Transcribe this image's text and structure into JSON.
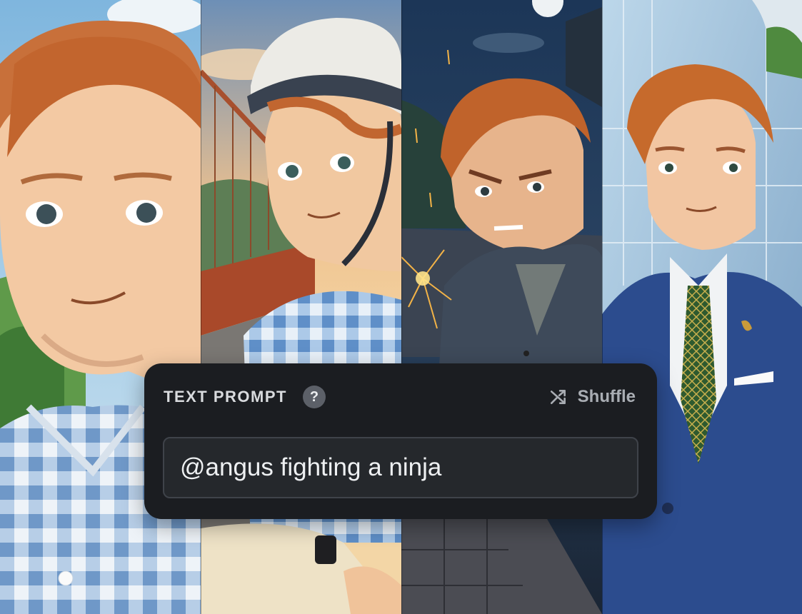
{
  "prompt_panel": {
    "title": "TEXT PROMPT",
    "help_symbol": "?",
    "shuffle_label": "Shuffle",
    "prompt_value": "@angus fighting a ninja"
  },
  "icons": [
    "question-mark-icon",
    "shuffle-icon"
  ],
  "colors": {
    "panel_background": "#1b1d21",
    "input_background": "#25282c",
    "input_border": "#3f434a",
    "title_text": "#d9dbde",
    "muted_text": "#a9adb3",
    "help_badge": "#5c6068"
  }
}
